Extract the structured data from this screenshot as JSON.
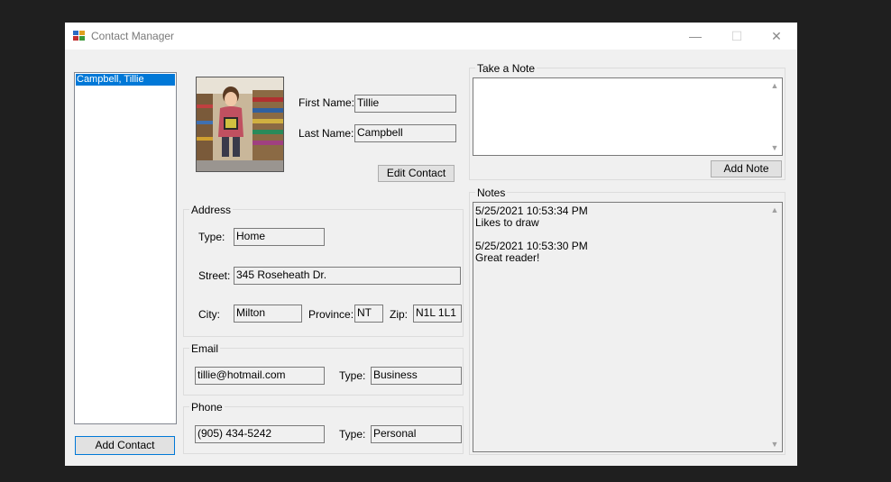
{
  "window": {
    "title": "Contact Manager",
    "minimize": "—",
    "maximize": "☐",
    "close": "✕"
  },
  "contacts": {
    "items": [
      "Campbell, Tillie"
    ],
    "add_label": "Add Contact"
  },
  "contact": {
    "first_name_label": "First Name:",
    "first_name": "Tillie",
    "last_name_label": "Last Name:",
    "last_name": "Campbell",
    "edit_label": "Edit Contact"
  },
  "address": {
    "group_title": "Address",
    "type_label": "Type:",
    "type": "Home",
    "street_label": "Street:",
    "street": "345 Roseheath Dr.",
    "city_label": "City:",
    "city": "Milton",
    "province_label": "Province:",
    "province": "NT",
    "zip_label": "Zip:",
    "zip": "N1L 1L1"
  },
  "email": {
    "group_title": "Email",
    "address": "tillie@hotmail.com",
    "type_label": "Type:",
    "type": "Business"
  },
  "phone": {
    "group_title": "Phone",
    "number": "(905) 434-5242",
    "type_label": "Type:",
    "type": "Personal"
  },
  "take_note": {
    "group_title": "Take a Note",
    "value": "",
    "add_label": "Add Note"
  },
  "notes": {
    "group_title": "Notes",
    "entries": [
      {
        "timestamp": "5/25/2021 10:53:34 PM",
        "text": "Likes to draw"
      },
      {
        "timestamp": "5/25/2021 10:53:30 PM",
        "text": "Great reader!"
      }
    ]
  },
  "colors": {
    "selection": "#0078d7",
    "window_bg": "#f0f0f0",
    "desktop_bg": "#1f1f1f"
  }
}
